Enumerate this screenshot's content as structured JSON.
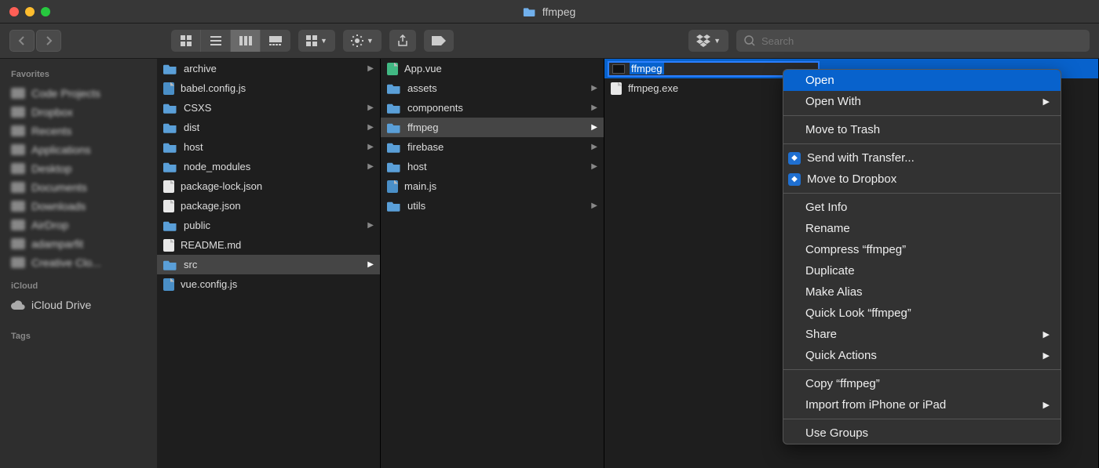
{
  "window": {
    "title": "ffmpeg"
  },
  "search": {
    "placeholder": "Search"
  },
  "sidebar": {
    "favorites_label": "Favorites",
    "blurred_items": [
      "Code Projects",
      "Dropbox",
      "Recents",
      "Applications",
      "Desktop",
      "Documents",
      "Downloads",
      "AirDrop",
      "adamparfit",
      "Creative Clo..."
    ],
    "icloud_label": "iCloud",
    "icloud_drive": "iCloud Drive",
    "tags_label": "Tags"
  },
  "columns": {
    "col1": [
      {
        "name": "archive",
        "type": "folder",
        "children": true
      },
      {
        "name": "babel.config.js",
        "type": "js"
      },
      {
        "name": "CSXS",
        "type": "folder",
        "children": true
      },
      {
        "name": "dist",
        "type": "folder",
        "children": true
      },
      {
        "name": "host",
        "type": "folder",
        "children": true
      },
      {
        "name": "node_modules",
        "type": "folder",
        "children": true
      },
      {
        "name": "package-lock.json",
        "type": "file"
      },
      {
        "name": "package.json",
        "type": "file"
      },
      {
        "name": "public",
        "type": "folder",
        "children": true
      },
      {
        "name": "README.md",
        "type": "file"
      },
      {
        "name": "src",
        "type": "folder",
        "children": true,
        "selected": true
      },
      {
        "name": "vue.config.js",
        "type": "js"
      }
    ],
    "col2": [
      {
        "name": "App.vue",
        "type": "vue"
      },
      {
        "name": "assets",
        "type": "folder",
        "children": true
      },
      {
        "name": "components",
        "type": "folder",
        "children": true
      },
      {
        "name": "ffmpeg",
        "type": "folder",
        "children": true,
        "selected": true
      },
      {
        "name": "firebase",
        "type": "folder",
        "children": true
      },
      {
        "name": "host",
        "type": "folder",
        "children": true
      },
      {
        "name": "main.js",
        "type": "js"
      },
      {
        "name": "utils",
        "type": "folder",
        "children": true
      }
    ],
    "col3": [
      {
        "name": "ffmpeg",
        "type": "exec",
        "highlighted": true,
        "renaming": true
      },
      {
        "name": "ffmpeg.exe",
        "type": "file"
      }
    ]
  },
  "context_menu": {
    "items": [
      {
        "label": "Open",
        "highlighted": true
      },
      {
        "label": "Open With",
        "submenu": true
      },
      {
        "sep": true
      },
      {
        "label": "Move to Trash"
      },
      {
        "sep": true
      },
      {
        "label": "Send with Transfer...",
        "icon": "dropbox"
      },
      {
        "label": "Move to Dropbox",
        "icon": "dropbox"
      },
      {
        "sep": true
      },
      {
        "label": "Get Info"
      },
      {
        "label": "Rename"
      },
      {
        "label": "Compress “ffmpeg”"
      },
      {
        "label": "Duplicate"
      },
      {
        "label": "Make Alias"
      },
      {
        "label": "Quick Look “ffmpeg”"
      },
      {
        "label": "Share",
        "submenu": true
      },
      {
        "label": "Quick Actions",
        "submenu": true
      },
      {
        "sep": true
      },
      {
        "label": "Copy “ffmpeg”"
      },
      {
        "label": "Import from iPhone or iPad",
        "submenu": true
      },
      {
        "sep": true
      },
      {
        "label": "Use Groups"
      }
    ]
  }
}
